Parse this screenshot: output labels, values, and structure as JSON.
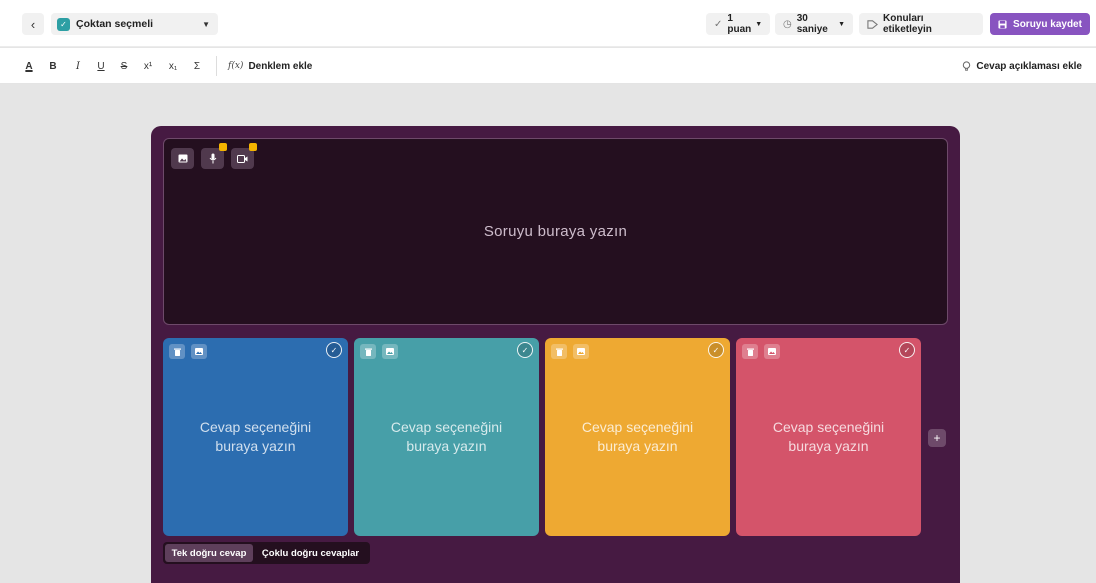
{
  "header": {
    "question_type": "Çoktan seçmeli",
    "points": "1 puan",
    "time": "30 saniye",
    "tag_topics": "Konuları etiketleyin",
    "save": "Soruyu kaydet"
  },
  "toolbar": {
    "text_color": "A",
    "bold": "B",
    "italic": "I",
    "underline": "U",
    "strikethrough": "S",
    "superscript": "x¹",
    "subscript": "x₁",
    "symbol": "Σ",
    "equation_icon": "f(x)",
    "equation": "Denklem ekle",
    "answer_explanation": "Cevap açıklaması ekle"
  },
  "question": {
    "placeholder": "Soruyu buraya yazın"
  },
  "answers": [
    {
      "placeholder": "Cevap seçeneğini buraya yazın",
      "color": "#2c6db0"
    },
    {
      "placeholder": "Cevap seçeneğini buraya yazın",
      "color": "#479fa8"
    },
    {
      "placeholder": "Cevap seçeneğini buraya yazın",
      "color": "#eea932"
    },
    {
      "placeholder": "Cevap seçeneğini buraya yazın",
      "color": "#d4546a"
    }
  ],
  "answer_mode": {
    "single": "Tek doğru cevap",
    "multiple": "Çoklu doğru cevaplar"
  },
  "colors": {
    "accent": "#8854c0",
    "editor_bg": "#461a42",
    "question_bg": "#240f1f"
  }
}
